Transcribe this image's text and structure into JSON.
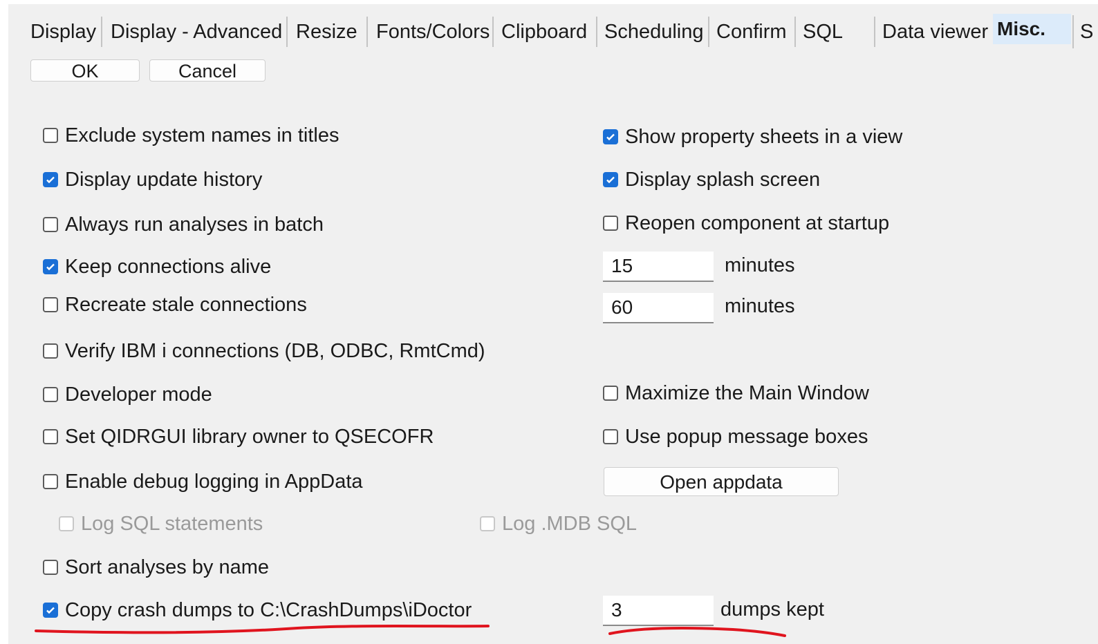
{
  "tabs": [
    {
      "label": "Display"
    },
    {
      "label": "Display - Advanced"
    },
    {
      "label": "Resize"
    },
    {
      "label": "Fonts/Colors"
    },
    {
      "label": "Clipboard"
    },
    {
      "label": "Scheduling"
    },
    {
      "label": "Confirm"
    },
    {
      "label": "SQL"
    },
    {
      "label": "Data viewer"
    },
    {
      "label": "Misc."
    }
  ],
  "buttons": {
    "ok": "OK",
    "cancel": "Cancel",
    "open_appdata": "Open appdata"
  },
  "left_options": [
    {
      "label": "Exclude system names in titles",
      "checked": false
    },
    {
      "label": "Display update history",
      "checked": true
    },
    {
      "label": "Always run analyses in batch",
      "checked": false
    },
    {
      "label": "Keep connections alive",
      "checked": true
    },
    {
      "label": "Recreate stale connections",
      "checked": false
    },
    {
      "label": "Verify IBM i connections (DB, ODBC, RmtCmd)",
      "checked": false
    },
    {
      "label": "Developer mode",
      "checked": false
    },
    {
      "label": "Set QIDRGUI library owner to QSECOFR",
      "checked": false
    },
    {
      "label": "Enable debug logging in AppData",
      "checked": false
    },
    {
      "label": "Log SQL statements",
      "checked": false,
      "disabled": true
    },
    {
      "label": "Sort analyses by name",
      "checked": false
    },
    {
      "label": "Copy crash dumps to C:\\CrashDumps\\iDoctor",
      "checked": true
    }
  ],
  "right_options": [
    {
      "label": "Show property sheets in a view",
      "checked": true
    },
    {
      "label": "Display splash screen",
      "checked": true
    },
    {
      "label": "Reopen component at startup",
      "checked": false
    },
    {
      "label": "Maximize the Main Window",
      "checked": false
    },
    {
      "label": "Use popup message boxes",
      "checked": false
    },
    {
      "label": "Log .MDB SQL",
      "checked": false,
      "disabled": true
    }
  ],
  "fields": {
    "keep_alive": {
      "value": "15",
      "unit": "minutes"
    },
    "stale": {
      "value": "60",
      "unit": "minutes"
    },
    "dumps": {
      "value": "3",
      "unit": "dumps kept"
    }
  },
  "colors": {
    "accent": "#1a6fd6",
    "annotation": "#e0141e",
    "active_tab": "#dcebfa",
    "panel": "#f0f0f0"
  }
}
